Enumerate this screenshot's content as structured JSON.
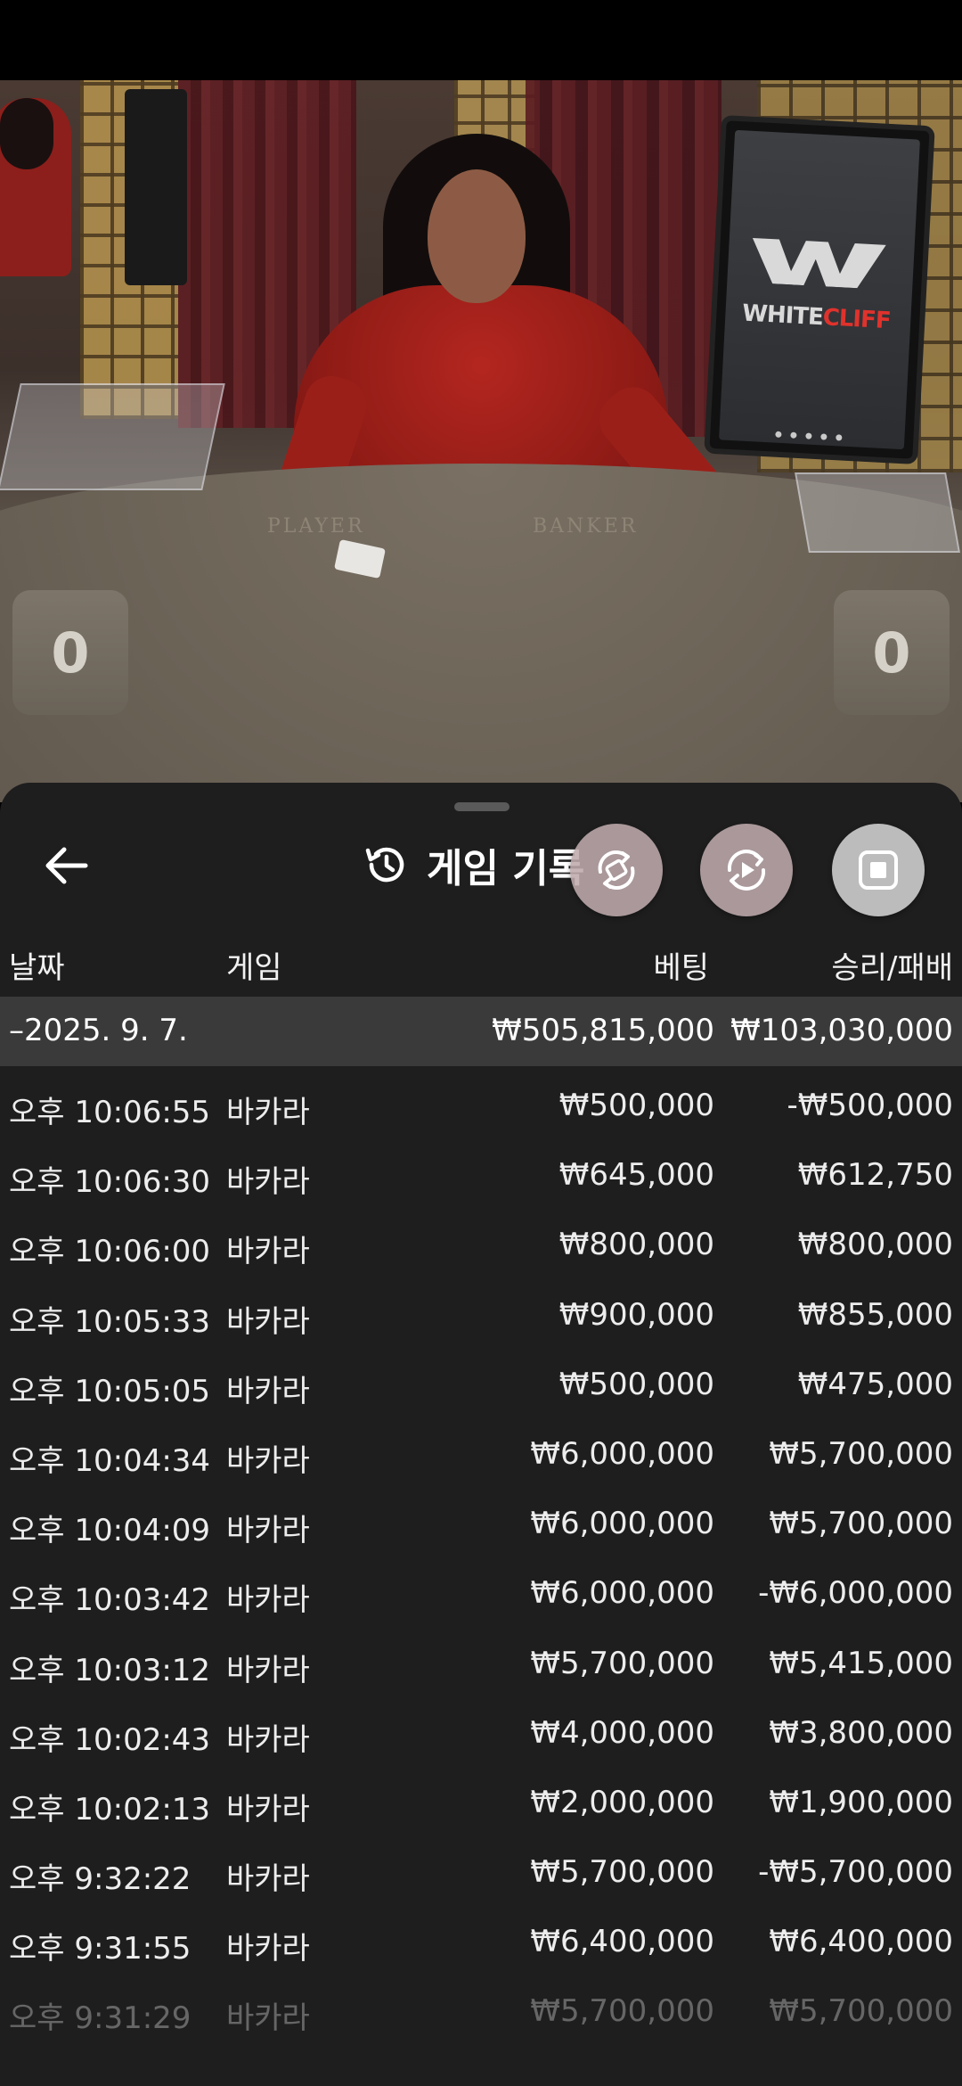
{
  "video": {
    "table_labels": {
      "player": "PLAYER",
      "banker": "BANKER"
    },
    "scores": {
      "player": "0",
      "banker": "0"
    },
    "monitor_logo": {
      "white": "WHITE",
      "cliff": "CLIFF"
    }
  },
  "sheet": {
    "title": "게임 기록",
    "back_icon": "arrow-left-icon",
    "title_icon": "history-icon"
  },
  "overlay_buttons": [
    {
      "icon": "auto-rotate-icon"
    },
    {
      "icon": "replay-icon"
    },
    {
      "icon": "stop-icon"
    }
  ],
  "columns": {
    "date": "날짜",
    "game": "게임",
    "bet": "베팅",
    "result": "승리/패배"
  },
  "summary": {
    "date": "–2025. 9. 7.",
    "bet": "₩505,815,000",
    "result": "₩103,030,000"
  },
  "rows": [
    {
      "time": "오후 10:06:55",
      "game": "바카라",
      "bet": "₩500,000",
      "result": "-₩500,000"
    },
    {
      "time": "오후 10:06:30",
      "game": "바카라",
      "bet": "₩645,000",
      "result": "₩612,750"
    },
    {
      "time": "오후 10:06:00",
      "game": "바카라",
      "bet": "₩800,000",
      "result": "₩800,000"
    },
    {
      "time": "오후 10:05:33",
      "game": "바카라",
      "bet": "₩900,000",
      "result": "₩855,000"
    },
    {
      "time": "오후 10:05:05",
      "game": "바카라",
      "bet": "₩500,000",
      "result": "₩475,000"
    },
    {
      "time": "오후 10:04:34",
      "game": "바카라",
      "bet": "₩6,000,000",
      "result": "₩5,700,000"
    },
    {
      "time": "오후 10:04:09",
      "game": "바카라",
      "bet": "₩6,000,000",
      "result": "₩5,700,000"
    },
    {
      "time": "오후 10:03:42",
      "game": "바카라",
      "bet": "₩6,000,000",
      "result": "-₩6,000,000"
    },
    {
      "time": "오후 10:03:12",
      "game": "바카라",
      "bet": "₩5,700,000",
      "result": "₩5,415,000"
    },
    {
      "time": "오후 10:02:43",
      "game": "바카라",
      "bet": "₩4,000,000",
      "result": "₩3,800,000"
    },
    {
      "time": "오후 10:02:13",
      "game": "바카라",
      "bet": "₩2,000,000",
      "result": "₩1,900,000"
    },
    {
      "time": "오후 9:32:22",
      "game": "바카라",
      "bet": "₩5,700,000",
      "result": "-₩5,700,000"
    },
    {
      "time": "오후 9:31:55",
      "game": "바카라",
      "bet": "₩6,400,000",
      "result": "₩6,400,000"
    },
    {
      "time": "오후 9:31:29",
      "game": "바카라",
      "bet": "₩5,700,000",
      "result": "₩5,700,000"
    }
  ]
}
